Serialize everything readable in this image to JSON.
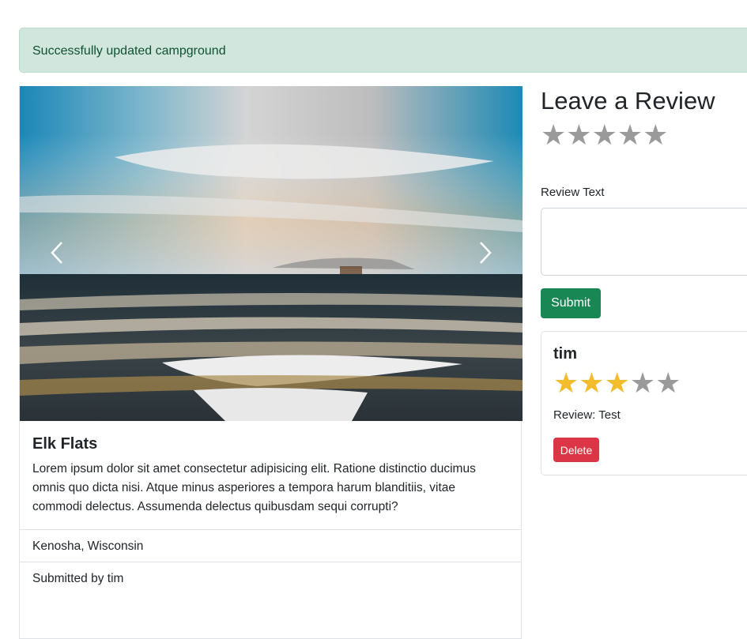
{
  "flash": {
    "message": "Successfully updated campground"
  },
  "campground": {
    "title": "Elk Flats",
    "description": "Lorem ipsum dolor sit amet consectetur adipisicing elit. Ratione distinctio ducimus omnis quo dicta nisi. Atque minus asperiores a tempora harum blanditiis, vitae commodi delectus. Assumenda delectus quibusdam sequi corrupti?",
    "location": "Kenosha, Wisconsin",
    "submitted_by": "Submitted by tim",
    "carousel": {
      "prev_icon": "chevron-left-icon",
      "next_icon": "chevron-right-icon"
    }
  },
  "review_form": {
    "heading": "Leave a Review",
    "rating_max": 5,
    "text_label": "Review Text",
    "text_value": "",
    "submit_label": "Submit"
  },
  "reviews": [
    {
      "author": "tim",
      "rating": 3,
      "rating_max": 5,
      "text": "Review: Test",
      "delete_label": "Delete"
    }
  ],
  "colors": {
    "success": "#198754",
    "danger": "#dc3545",
    "star_on": "#f3bc2c",
    "star_off": "#9a9a9a",
    "alert_bg": "#d1e7dd"
  }
}
